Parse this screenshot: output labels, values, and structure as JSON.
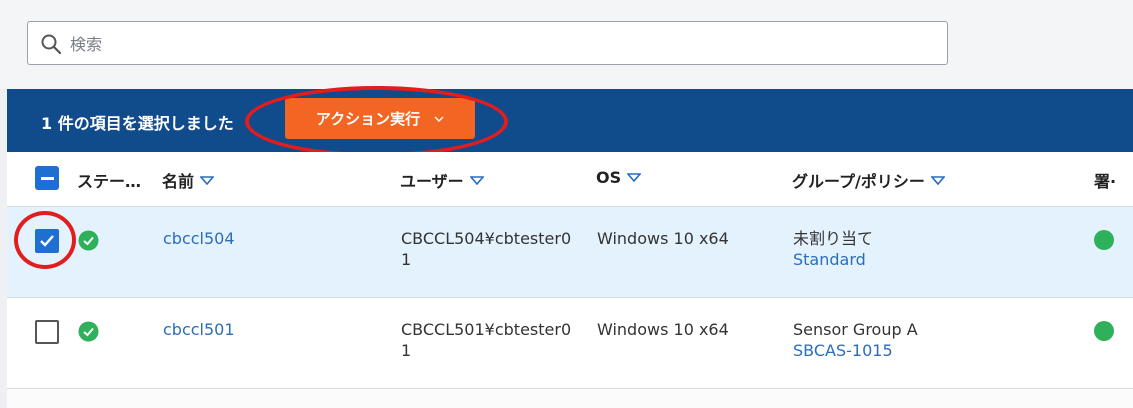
{
  "search": {
    "placeholder": "検索"
  },
  "selection_bar": {
    "text": "1 件の項目を選択しました",
    "action_button_label": "アクション実行"
  },
  "table": {
    "columns": [
      {
        "label": "ステー…"
      },
      {
        "label": "名前"
      },
      {
        "label": "ユーザー"
      },
      {
        "label": "OS"
      },
      {
        "label": "グループ/ポリシー"
      },
      {
        "label": "署·"
      }
    ],
    "rows": [
      {
        "selected": true,
        "status": "ok",
        "name": "cbccl504",
        "user_line1": "CBCCL504¥cbtester0",
        "user_line2": "1",
        "os": "Windows 10 x64",
        "group": "未割り当て",
        "policy": "Standard"
      },
      {
        "selected": false,
        "status": "ok",
        "name": "cbccl501",
        "user_line1": "CBCCL501¥cbtester0",
        "user_line2": "1",
        "os": "Windows 10 x64",
        "group": "Sensor Group A",
        "policy": "SBCAS-1015"
      }
    ]
  },
  "colors": {
    "selection_bar": "#104b8c",
    "action_button": "#f26522",
    "status_ok": "#2eb15a",
    "link": "#2a6ebb",
    "annotation": "#e11d1d"
  }
}
